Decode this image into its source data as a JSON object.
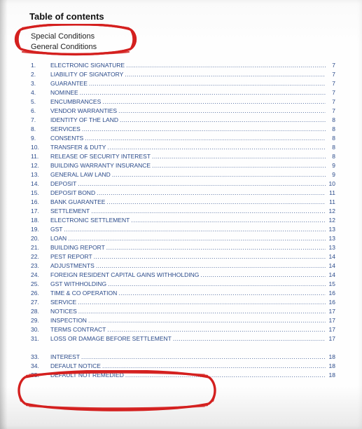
{
  "title": "Table of contents",
  "headings": {
    "special": "Special Conditions",
    "general": "General Conditions"
  },
  "toc": [
    {
      "n": "1.",
      "label": "ELECTRONIC SIGNATURE",
      "p": "7"
    },
    {
      "n": "2.",
      "label": "LIABILITY OF SIGNATORY",
      "p": "7"
    },
    {
      "n": "3.",
      "label": "GUARANTEE",
      "p": "7"
    },
    {
      "n": "4.",
      "label": "NOMINEE",
      "p": "7"
    },
    {
      "n": "5.",
      "label": "ENCUMBRANCES",
      "p": "7"
    },
    {
      "n": "6.",
      "label": "VENDOR WARRANTIES",
      "p": "7"
    },
    {
      "n": "7.",
      "label": "IDENTITY OF THE LAND",
      "p": "8"
    },
    {
      "n": "8.",
      "label": "SERVICES",
      "p": "8"
    },
    {
      "n": "9.",
      "label": "CONSENTS",
      "p": "8"
    },
    {
      "n": "10.",
      "label": "TRANSFER & DUTY",
      "p": "8"
    },
    {
      "n": "11.",
      "label": "RELEASE OF SECURITY INTEREST",
      "p": "8"
    },
    {
      "n": "12.",
      "label": "BUILDING WARRANTY INSURANCE",
      "p": "9"
    },
    {
      "n": "13.",
      "label": "GENERAL LAW LAND",
      "p": "9"
    },
    {
      "n": "14.",
      "label": "DEPOSIT",
      "p": "10"
    },
    {
      "n": "15.",
      "label": "DEPOSIT BOND",
      "p": "11"
    },
    {
      "n": "16.",
      "label": "BANK GUARANTEE",
      "p": "11"
    },
    {
      "n": "17.",
      "label": "SETTLEMENT",
      "p": "12"
    },
    {
      "n": "18.",
      "label": "ELECTRONIC SETTLEMENT",
      "p": "12"
    },
    {
      "n": "19.",
      "label": "GST",
      "p": "13"
    },
    {
      "n": "20.",
      "label": "LOAN",
      "p": "13"
    },
    {
      "n": "21.",
      "label": "BUILDING REPORT",
      "p": "13"
    },
    {
      "n": "22.",
      "label": "PEST REPORT",
      "p": "14"
    },
    {
      "n": "23.",
      "label": "ADJUSTMENTS",
      "p": "14"
    },
    {
      "n": "24.",
      "label": "FOREIGN RESIDENT CAPITAL GAINS WITHHOLDING",
      "p": "14"
    },
    {
      "n": "25.",
      "label": "GST WITHHOLDING",
      "p": "15"
    },
    {
      "n": "26.",
      "label": "TIME & CO OPERATION",
      "p": "16"
    },
    {
      "n": "27.",
      "label": "SERVICE",
      "p": "16"
    },
    {
      "n": "28.",
      "label": "NOTICES",
      "p": "17"
    },
    {
      "n": "29.",
      "label": "INSPECTION",
      "p": "17"
    },
    {
      "n": "30.",
      "label": "TERMS CONTRACT",
      "p": "17"
    },
    {
      "n": "31.",
      "label": "LOSS OR DAMAGE BEFORE SETTLEMENT",
      "p": "17"
    },
    {
      "n": "",
      "label": "",
      "p": "",
      "gap": true
    },
    {
      "n": "33.",
      "label": "INTEREST",
      "p": "18"
    },
    {
      "n": "34.",
      "label": "DEFAULT NOTICE",
      "p": "18"
    },
    {
      "n": "35.",
      "label": "DEFAULT NOT REMEDIED",
      "p": "18"
    }
  ]
}
